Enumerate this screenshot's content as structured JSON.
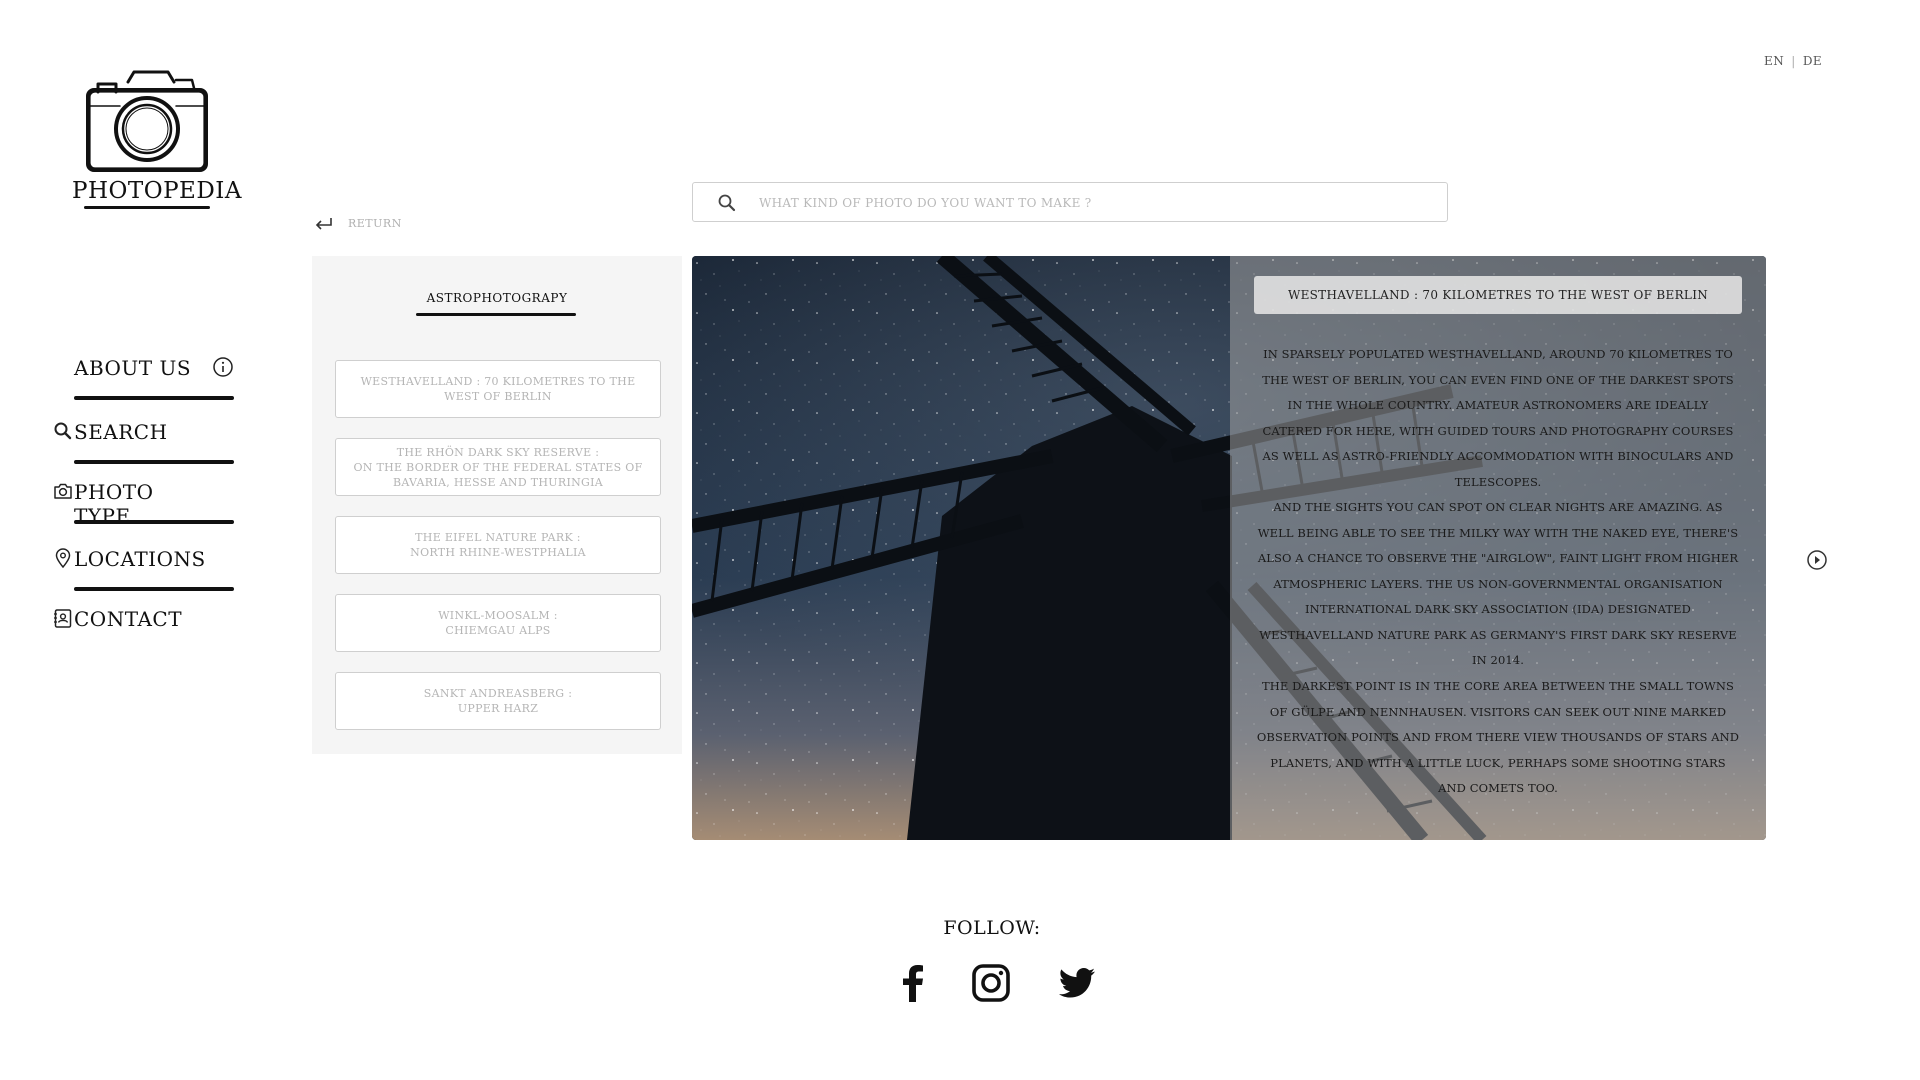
{
  "lang": {
    "en": "EN",
    "separator": "|",
    "de": "DE"
  },
  "logo": {
    "text": "PHOTOPEDIA"
  },
  "nav": [
    {
      "label": "ABOUT US",
      "icon": "info-icon"
    },
    {
      "label": "SEARCH",
      "icon": "search-icon"
    },
    {
      "label": "PHOTO TYPE",
      "icon": "camera-icon"
    },
    {
      "label": "LOCATIONS",
      "icon": "location-pin-icon"
    },
    {
      "label": "CONTACT",
      "icon": "contact-card-icon"
    }
  ],
  "search": {
    "placeholder": "WHAT KIND OF PHOTO DO YOU WANT TO MAKE ?",
    "value": ""
  },
  "return": {
    "label": "RETURN"
  },
  "panel": {
    "title": "ASTROPHOTOGRAPY",
    "locations": [
      "WESTHAVELLAND : 70 KILOMETRES TO THE\nWEST OF BERLIN",
      "THE RHÖN DARK SKY RESERVE :\nON THE BORDER OF THE FEDERAL STATES OF\nBAVARIA, HESSE AND THURINGIA",
      "THE EIFEL NATURE PARK :\nNORTH RHINE-WESTPHALIA",
      "WINKL-MOOSALM :\nCHIEMGAU ALPS",
      "SANKT ANDREASBERG :\nUPPER HARZ"
    ]
  },
  "info": {
    "title": "WESTHAVELLAND : 70 KILOMETRES TO THE WEST OF BERLIN",
    "paragraphs": [
      "In sparsely populated Westhavelland, around 70 kilometres to the west of Berlin, you can even find one of the darkest spots in the whole country. Amateur astronomers are ideally catered for here, with guided tours and photography courses as well as astro-friendly accommodation with binoculars and telescopes.",
      "And the sights you can spot on clear nights are amazing. As well being able to see the Milky Way with the naked eye, there's also a chance to observe the \"airglow\", faint light from higher atmospheric layers. The US non-governmental organisation International Dark Sky Association (IDA) designated Westhavelland Nature Park as Germany's first dark sky reserve in 2014.",
      "The darkest point is in the core area between the small towns of Gülpe and Nennhausen. Visitors can seek out nine marked observation points and from there view thousands of stars and planets, and with a little luck, perhaps some shooting stars and comets too."
    ]
  },
  "footer": {
    "follow": "FOLLOW:",
    "social": [
      "facebook-icon",
      "instagram-icon",
      "twitter-icon"
    ]
  },
  "colors": {
    "text": "#111111",
    "muted": "#b5b5b5",
    "panel_bg": "#f5f5f5",
    "sky": "#1b2634"
  }
}
